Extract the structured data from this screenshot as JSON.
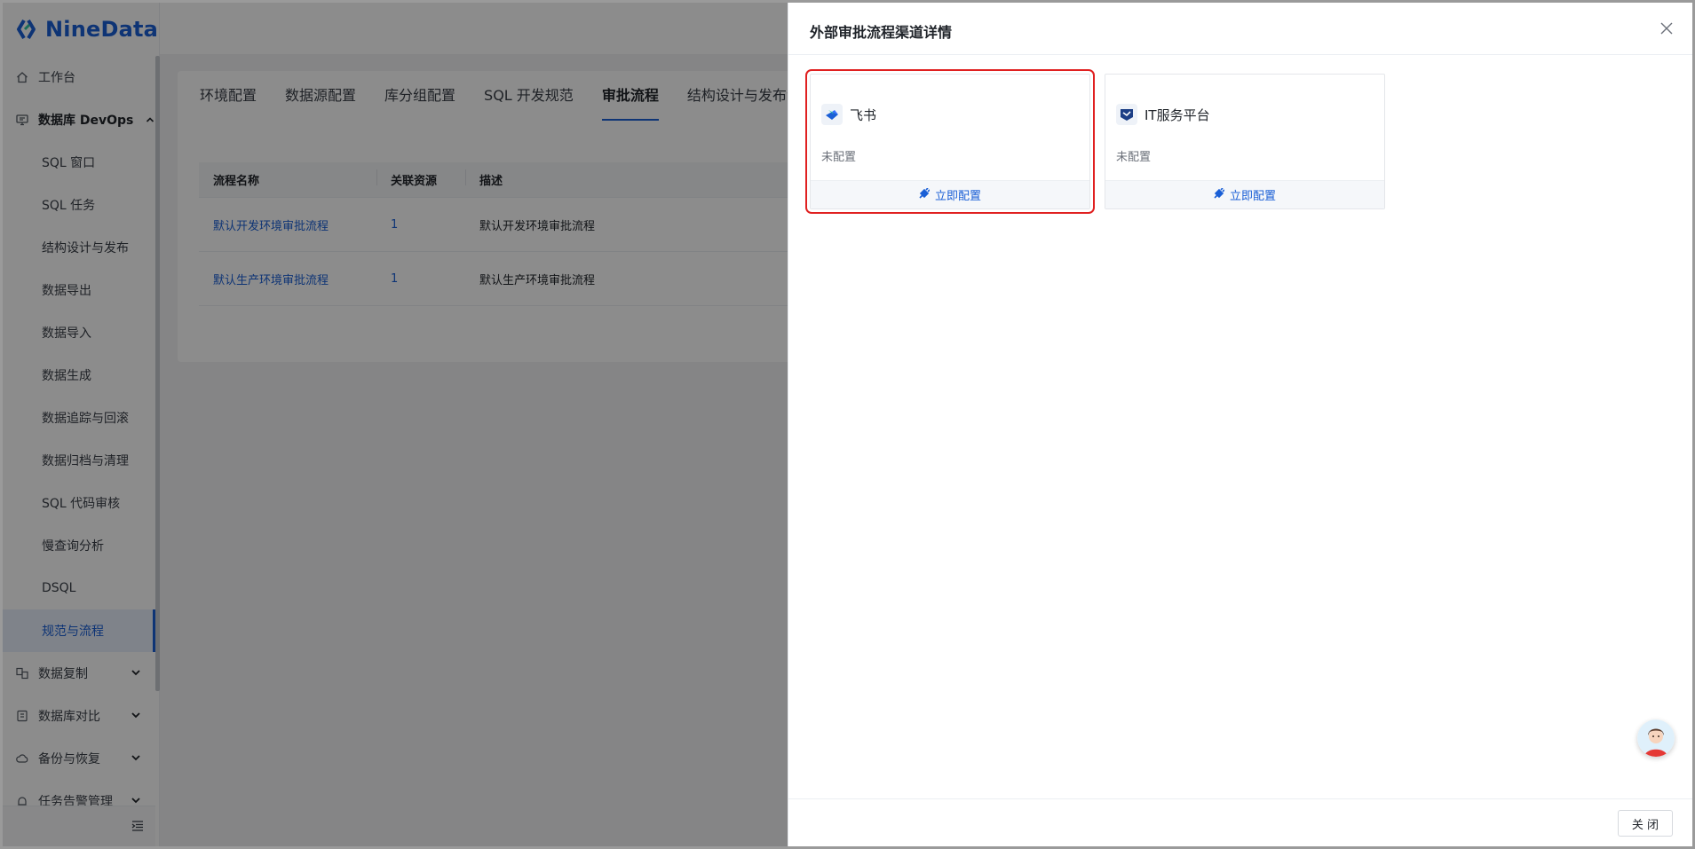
{
  "brand": {
    "name": "NineData",
    "color": "#1a5fd6"
  },
  "sidebar": {
    "top_items": [
      {
        "label": "工作台",
        "icon": "home-icon"
      },
      {
        "label": "数据库 DevOps",
        "icon": "monitor-icon",
        "expanded": true
      }
    ],
    "devops_items": [
      {
        "label": "SQL 窗口"
      },
      {
        "label": "SQL 任务"
      },
      {
        "label": "结构设计与发布"
      },
      {
        "label": "数据导出"
      },
      {
        "label": "数据导入"
      },
      {
        "label": "数据生成"
      },
      {
        "label": "数据追踪与回滚"
      },
      {
        "label": "数据归档与清理"
      },
      {
        "label": "SQL 代码审核"
      },
      {
        "label": "慢查询分析"
      },
      {
        "label": "DSQL"
      },
      {
        "label": "规范与流程",
        "active": true
      }
    ],
    "bottom_items": [
      {
        "label": "数据复制",
        "icon": "replication-icon"
      },
      {
        "label": "数据库对比",
        "icon": "compare-icon"
      },
      {
        "label": "备份与恢复",
        "icon": "cloud-backup-icon"
      },
      {
        "label": "任务告警管理",
        "icon": "alarm-icon"
      }
    ]
  },
  "main": {
    "tabs": [
      {
        "label": "环境配置"
      },
      {
        "label": "数据源配置"
      },
      {
        "label": "库分组配置"
      },
      {
        "label": "SQL 开发规范"
      },
      {
        "label": "审批流程",
        "active": true
      },
      {
        "label": "结构设计与发布流程"
      }
    ],
    "table": {
      "columns": [
        "流程名称",
        "关联资源",
        "描述"
      ],
      "rows": [
        {
          "name": "默认开发环境审批流程",
          "resources": "1",
          "description": "默认开发环境审批流程"
        },
        {
          "name": "默认生产环境审批流程",
          "resources": "1",
          "description": "默认生产环境审批流程"
        }
      ]
    }
  },
  "drawer": {
    "title": "外部审批流程渠道详情",
    "cards": [
      {
        "name": "飞书",
        "status": "未配置",
        "action": "立即配置",
        "icon": "feishu-logo-icon",
        "highlighted": true
      },
      {
        "name": "IT服务平台",
        "status": "未配置",
        "action": "立即配置",
        "icon": "it-service-logo-icon",
        "highlighted": false
      }
    ],
    "footer": {
      "close_label": "关 闭"
    }
  },
  "colors": {
    "accent": "#1a5fd6",
    "highlight": "#e02020",
    "mask": "rgba(0,0,0,0.45)"
  }
}
